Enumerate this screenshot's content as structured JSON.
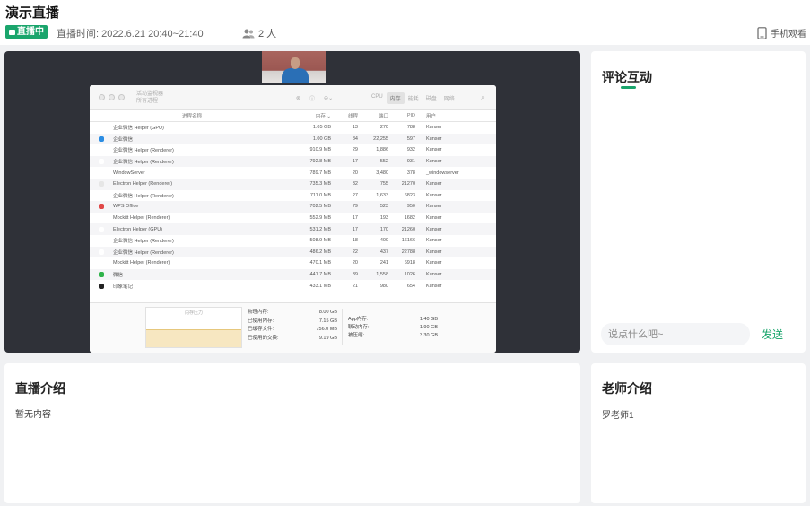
{
  "header": {
    "title": "演示直播",
    "badge_label": "直播中",
    "time_label": "直播时间: 2022.6.21 20:40~21:40",
    "viewer_count": "2 人",
    "mobile_label": "手机观看"
  },
  "colors": {
    "accent": "#1aa56c",
    "video_bg": "#2f3138",
    "page_bg": "#f0f1f3"
  },
  "screen_share": {
    "window_title": "活动监视器",
    "window_subtitle": "所有进程",
    "tabs": [
      "CPU",
      "内存",
      "能耗",
      "磁盘",
      "网络"
    ],
    "active_tab": "内存",
    "columns": [
      "进程名称",
      "内存 ⌄",
      "线程",
      "端口",
      "PID",
      "用户"
    ],
    "rows": [
      {
        "icon_color": "#ffffff",
        "name": "企业微信 Helper (GPU)",
        "mem": "1.05 GB",
        "threads": "13",
        "ports": "270",
        "pid": "788",
        "user": "Kunser"
      },
      {
        "icon_color": "#2b8de3",
        "name": "企业微信",
        "mem": "1.00 GB",
        "threads": "84",
        "ports": "22,255",
        "pid": "597",
        "user": "Kunser"
      },
      {
        "icon_color": "#ffffff",
        "name": "企业微信 Helper (Renderer)",
        "mem": "910.9 MB",
        "threads": "29",
        "ports": "1,886",
        "pid": "932",
        "user": "Kunser"
      },
      {
        "icon_color": "#ffffff",
        "name": "企业微信 Helper (Renderer)",
        "mem": "792.8 MB",
        "threads": "17",
        "ports": "552",
        "pid": "931",
        "user": "Kunser"
      },
      {
        "icon_color": "#ffffff",
        "name": "WindowServer",
        "mem": "789.7 MB",
        "threads": "20",
        "ports": "3,480",
        "pid": "378",
        "user": "_windowserver"
      },
      {
        "icon_color": "#e6e6e6",
        "name": "Electron Helper (Renderer)",
        "mem": "735.3 MB",
        "threads": "32",
        "ports": "755",
        "pid": "21270",
        "user": "Kunser"
      },
      {
        "icon_color": "#ffffff",
        "name": "企业微信 Helper (Renderer)",
        "mem": "711.0 MB",
        "threads": "27",
        "ports": "1,633",
        "pid": "6823",
        "user": "Kunser"
      },
      {
        "icon_color": "#e04848",
        "name": "WPS Office",
        "mem": "702.5 MB",
        "threads": "79",
        "ports": "523",
        "pid": "950",
        "user": "Kunser"
      },
      {
        "icon_color": "#ffffff",
        "name": "Mockitt Helper (Renderer)",
        "mem": "552.9 MB",
        "threads": "17",
        "ports": "193",
        "pid": "1682",
        "user": "Kunser"
      },
      {
        "icon_color": "#ffffff",
        "name": "Electron Helper (GPU)",
        "mem": "531.2 MB",
        "threads": "17",
        "ports": "170",
        "pid": "21260",
        "user": "Kunser"
      },
      {
        "icon_color": "#ffffff",
        "name": "企业微信 Helper (Renderer)",
        "mem": "508.9 MB",
        "threads": "18",
        "ports": "400",
        "pid": "16166",
        "user": "Kunser"
      },
      {
        "icon_color": "#ffffff",
        "name": "企业微信 Helper (Renderer)",
        "mem": "486.2 MB",
        "threads": "22",
        "ports": "437",
        "pid": "22788",
        "user": "Kunser"
      },
      {
        "icon_color": "#ffffff",
        "name": "Mockitt Helper (Renderer)",
        "mem": "470.1 MB",
        "threads": "20",
        "ports": "241",
        "pid": "6918",
        "user": "Kunser"
      },
      {
        "icon_color": "#2fb34a",
        "name": "微信",
        "mem": "441.7 MB",
        "threads": "39",
        "ports": "1,558",
        "pid": "1026",
        "user": "Kunser"
      },
      {
        "icon_color": "#222222",
        "name": "印象笔记",
        "mem": "433.1 MB",
        "threads": "21",
        "ports": "980",
        "pid": "654",
        "user": "Kunser"
      }
    ],
    "memory_graph_label": "内存压力",
    "mem_stats": [
      {
        "label": "物理内存:",
        "value": "8.00 GB"
      },
      {
        "label": "已使用内存:",
        "value": "7.15 GB"
      },
      {
        "label": "已缓存文件:",
        "value": "756.0 MB"
      },
      {
        "label": "已使用的交换:",
        "value": "9.19 GB"
      }
    ],
    "mem_stats2": [
      {
        "label": "App内存:",
        "value": "1.40 GB"
      },
      {
        "label": "联动内存:",
        "value": "1.90 GB"
      },
      {
        "label": "被压缩:",
        "value": "3.30 GB"
      }
    ]
  },
  "comments": {
    "title": "评论互动",
    "input_placeholder": "说点什么吧~",
    "send_label": "发送"
  },
  "intro": {
    "title": "直播介绍",
    "body": "暂无内容"
  },
  "teacher": {
    "title": "老师介绍",
    "name": "罗老师1"
  }
}
